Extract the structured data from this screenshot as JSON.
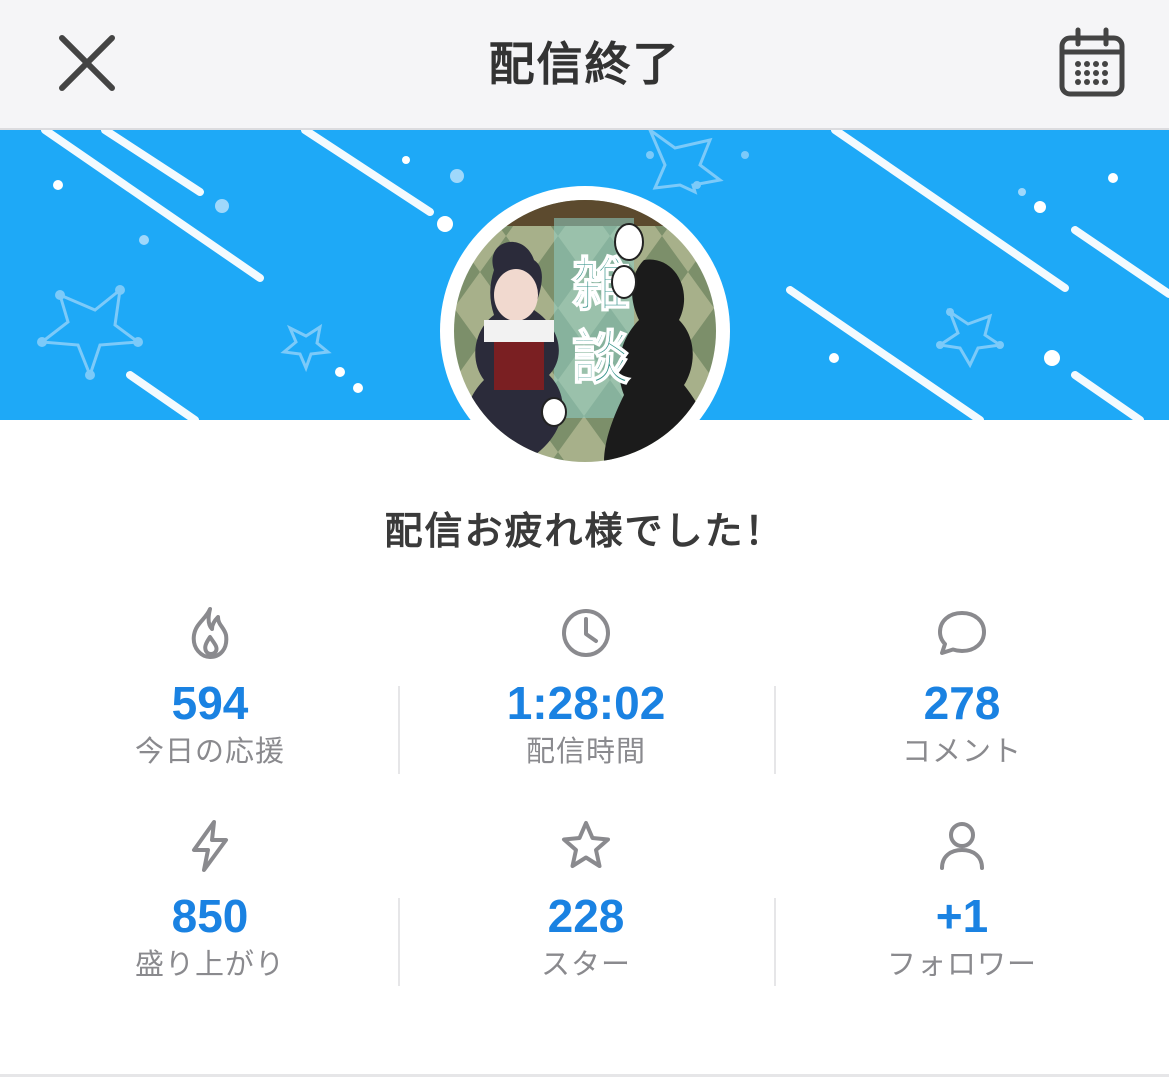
{
  "header": {
    "title": "配信終了",
    "close_icon": "close-icon",
    "calendar_icon": "calendar-icon"
  },
  "banner": {
    "color": "#1ea9f7",
    "thumbnail_text": "雑談"
  },
  "message": "配信お疲れ様でした！",
  "stats": [
    {
      "icon": "flame-icon",
      "value": "594",
      "label": "今日の応援"
    },
    {
      "icon": "clock-icon",
      "value": "1:28:02",
      "label": "配信時間"
    },
    {
      "icon": "comment-icon",
      "value": "278",
      "label": "コメント"
    },
    {
      "icon": "lightning-icon",
      "value": "850",
      "label": "盛り上がり"
    },
    {
      "icon": "star-icon",
      "value": "228",
      "label": "スター"
    },
    {
      "icon": "user-icon",
      "value": "+1",
      "label": "フォロワー"
    }
  ],
  "colors": {
    "accent": "#1a82e2",
    "label": "#8a8a8e",
    "icon": "#8a8a8e"
  }
}
